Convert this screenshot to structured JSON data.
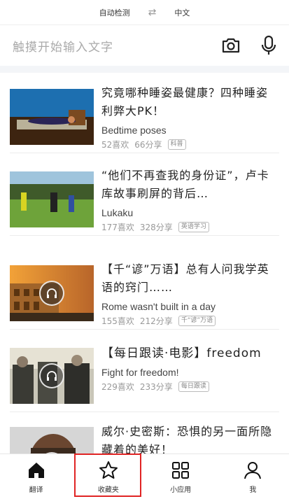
{
  "lang": {
    "source": "自动检测",
    "target": "中文"
  },
  "search": {
    "placeholder": "触摸开始输入文字"
  },
  "feed": [
    {
      "title": "究竟哪种睡姿最健康？四种睡姿利弊大PK！",
      "subtitle": "Bedtime poses",
      "likes": "52喜欢",
      "shares": "66分享",
      "tag": "科普",
      "play": false
    },
    {
      "title": "“他们不再查我的身份证”，卢卡库故事刷屏的背后…",
      "subtitle": "Lukaku",
      "likes": "177喜欢",
      "shares": "328分享",
      "tag": "英语学习",
      "play": false
    },
    {
      "title": "【千“谚”万语】总有人问我学英语的窍门……",
      "subtitle": "Rome wasn't built in a day",
      "likes": "155喜欢",
      "shares": "212分享",
      "tag": "千“谚”万语",
      "play": true
    },
    {
      "title": "【每日跟读·电影】freedom",
      "subtitle": "Fight for freedom!",
      "likes": "229喜欢",
      "shares": "233分享",
      "tag": "每日跟读",
      "play": true
    },
    {
      "title": "威尔·史密斯：恐惧的另一面所隐藏着的美好！",
      "subtitle": "",
      "likes": "",
      "shares": "",
      "tag": "",
      "play": true
    }
  ],
  "tabs": [
    {
      "label": "翻译",
      "icon": "home-icon"
    },
    {
      "label": "收藏夹",
      "icon": "star-icon"
    },
    {
      "label": "小应用",
      "icon": "grid-icon"
    },
    {
      "label": "我",
      "icon": "person-icon"
    }
  ],
  "colors": {
    "highlight": "#e02424",
    "divider": "#f3f5f8"
  }
}
